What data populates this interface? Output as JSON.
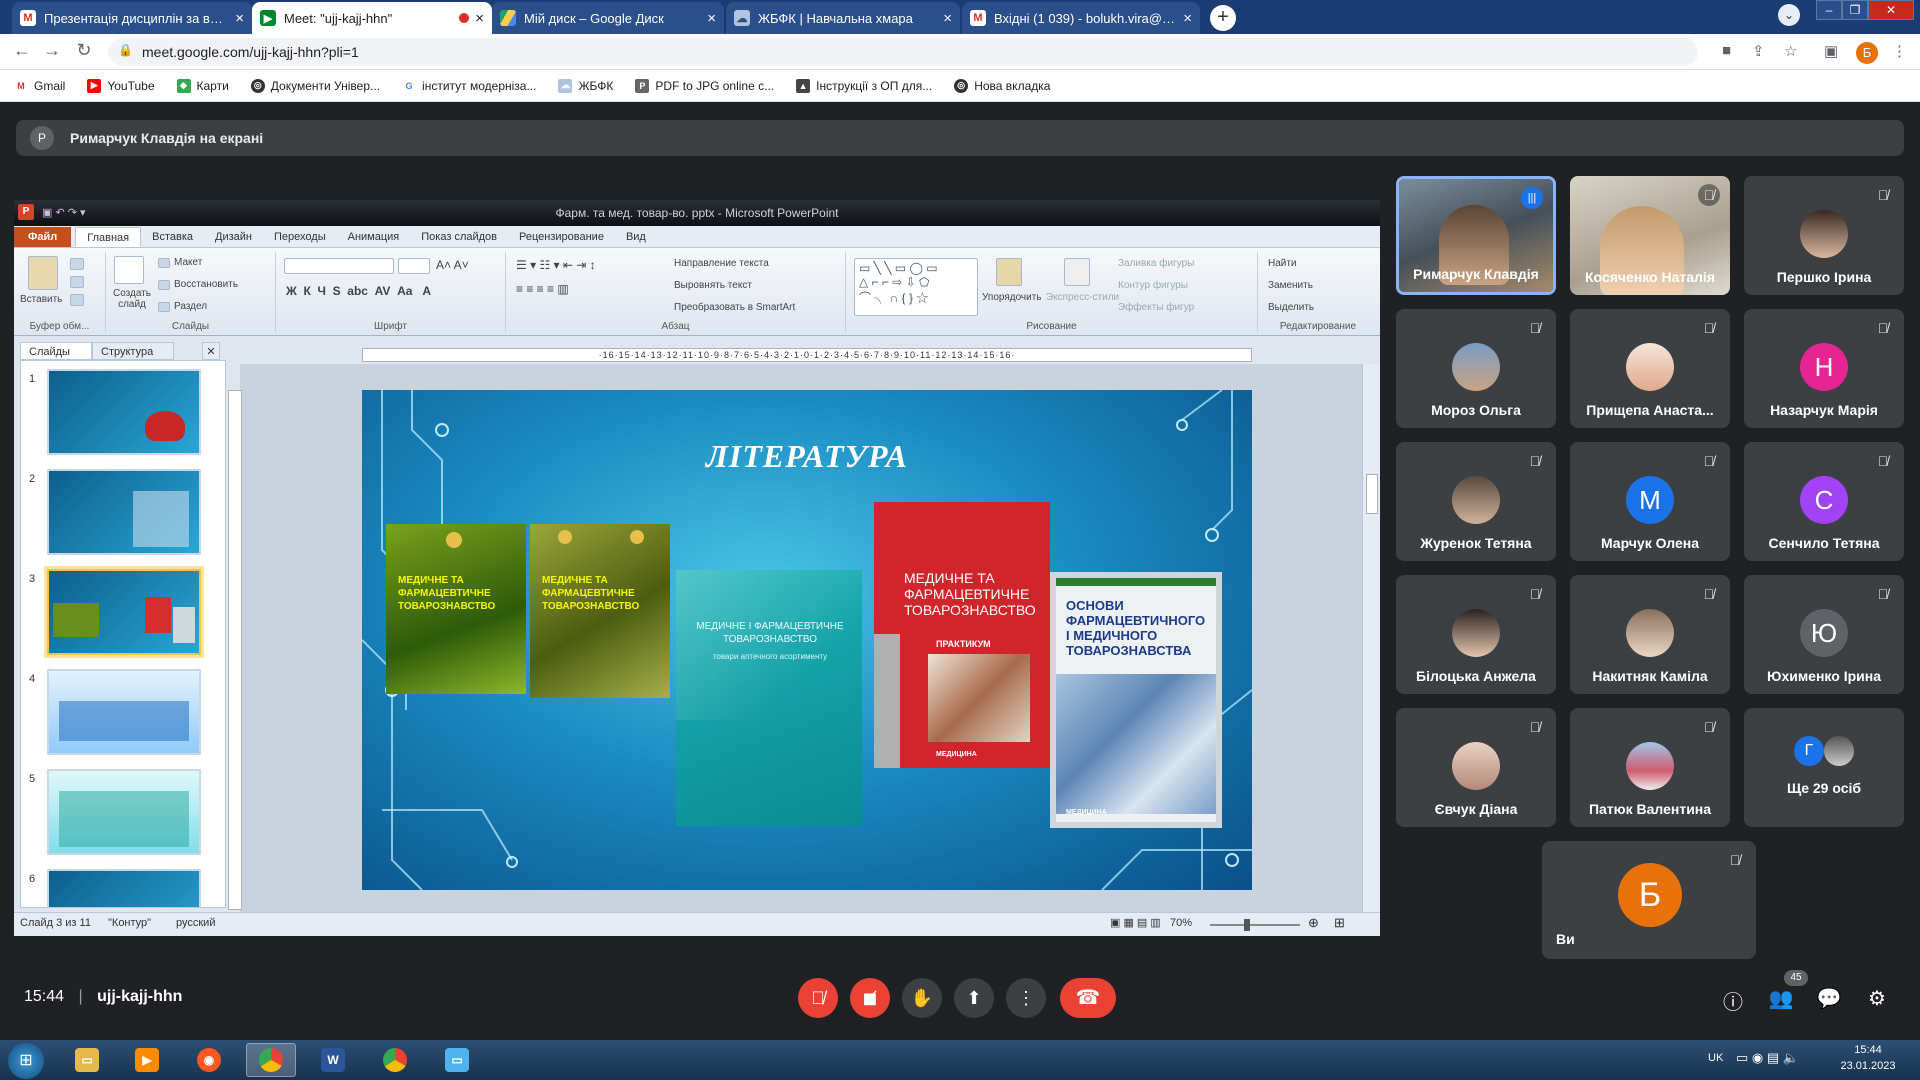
{
  "browser": {
    "tabs": [
      {
        "title": "Презентація дисциплін за вибо",
        "favicon": "gmail-icon",
        "active": false
      },
      {
        "title": "Meet: \"ujj-kajj-hhn\"",
        "favicon": "meet-icon",
        "active": true
      },
      {
        "title": "Мій диск – Google Диск",
        "favicon": "drive-icon",
        "active": false
      },
      {
        "title": "ЖБФК | Навчальна хмара",
        "favicon": "cloud-icon",
        "active": false
      },
      {
        "title": "Вхідні (1 039) - bolukh.vira@pha",
        "favicon": "gmail-icon",
        "active": false
      }
    ],
    "url": "meet.google.com/ujj-kajj-hhn?pli=1",
    "profile_initial": "Б",
    "bookmarks": [
      "Gmail",
      "YouTube",
      "Карти",
      "Документи Універ...",
      "інститут модерніза...",
      "ЖБФК",
      "PDF to JPG online c...",
      "Інструкції з ОП для...",
      "Нова вкладка"
    ]
  },
  "meet": {
    "presenter_initial": "Р",
    "presenting_text": "Римарчук Клавдія на екрані",
    "time": "15:44",
    "meeting_code": "ujj-kajj-hhn",
    "participants_count": "45",
    "participants": [
      {
        "name": "Римарчук Клавдія",
        "state": "speaking"
      },
      {
        "name": "Косяченко Наталія",
        "state": "muted"
      },
      {
        "name": "Першко Ірина",
        "state": "muted"
      },
      {
        "name": "Мороз Ольга",
        "state": "muted"
      },
      {
        "name": "Прищепа Анаста...",
        "state": "muted"
      },
      {
        "name": "Назарчук Марія",
        "state": "muted",
        "initial": "Н",
        "color": "#e52592"
      },
      {
        "name": "Журенок Тетяна",
        "state": "muted"
      },
      {
        "name": "Марчук Олена",
        "state": "muted",
        "initial": "М",
        "color": "#1a73e8"
      },
      {
        "name": "Сенчило Тетяна",
        "state": "muted",
        "initial": "С",
        "color": "#a142f4"
      },
      {
        "name": "Білоцька Анжела",
        "state": "muted"
      },
      {
        "name": "Накитняк Каміла",
        "state": "muted"
      },
      {
        "name": "Юхименко Ірина",
        "state": "muted",
        "initial": "Ю",
        "color": "#5f6368"
      },
      {
        "name": "Євчук Діана",
        "state": "muted"
      },
      {
        "name": "Патюк Валентина",
        "state": "muted"
      }
    ],
    "more_tile": {
      "text": "Ще 29 осіб",
      "initial": "Г"
    },
    "self_tile": {
      "name": "Ви",
      "initial": "Б"
    }
  },
  "powerpoint": {
    "title": "Фарм. та мед. товар-во. pptx - Microsoft PowerPoint",
    "menu": [
      "Файл",
      "Главная",
      "Вставка",
      "Дизайн",
      "Переходы",
      "Анимация",
      "Показ слайдов",
      "Рецензирование",
      "Вид"
    ],
    "active_menu": "Главная",
    "ribbon": {
      "clipboard": {
        "label": "Буфер обм...",
        "paste": "Вставить"
      },
      "slides": {
        "label": "Слайды",
        "new_slide": "Создать слайд",
        "layout": "Макет",
        "reset": "Восстановить",
        "section": "Раздел"
      },
      "font": {
        "label": "Шрифт"
      },
      "paragraph": {
        "label": "Абзац",
        "text_direction": "Направление текста",
        "align_text": "Выровнять текст",
        "smartart": "Преобразовать в SmartArt"
      },
      "drawing": {
        "label": "Рисование",
        "arrange": "Упорядочить",
        "quick_styles": "Экспресс-стили",
        "fill": "Заливка фигуры",
        "outline": "Контур фигуры",
        "effects": "Эффекты фигур"
      },
      "editing": {
        "label": "Редактирование",
        "find": "Найти",
        "replace": "Заменить",
        "select": "Выделить"
      }
    },
    "panel_tabs": [
      "Слайды",
      "Структура"
    ],
    "slide_numbers": [
      "1",
      "2",
      "3",
      "4",
      "5",
      "6"
    ],
    "current_slide": 3,
    "ruler_text": "·16·15·14·13·12·11·10·9·8·7·6·5·4·3·2·1·0·1·2·3·4·5·6·7·8·9·10·11·12·13·14·15·16·",
    "slide": {
      "title": "ЛІТЕРАТУРА",
      "books": [
        "Медичне та фармацевтичне товарознавство",
        "Медичне та фармацевтичне товарознавство",
        "Медичне і фармацевтичне товарознавство",
        "Медичне та фармацевтичне товарознавство",
        "Основи фармацевтичного і медичного товарознавства"
      ],
      "book3_subtitle": "товари аптечного асортименту",
      "book4_sub": "практикум",
      "book4_footer": "медицина",
      "book5_footer": "медицина"
    },
    "status": {
      "slide_info": "Слайд 3 из 11",
      "theme": "\"Контур\"",
      "language": "русский",
      "zoom": "70%"
    }
  },
  "taskbar": {
    "lang": "UK",
    "time": "15:44",
    "date": "23.01.2023"
  }
}
